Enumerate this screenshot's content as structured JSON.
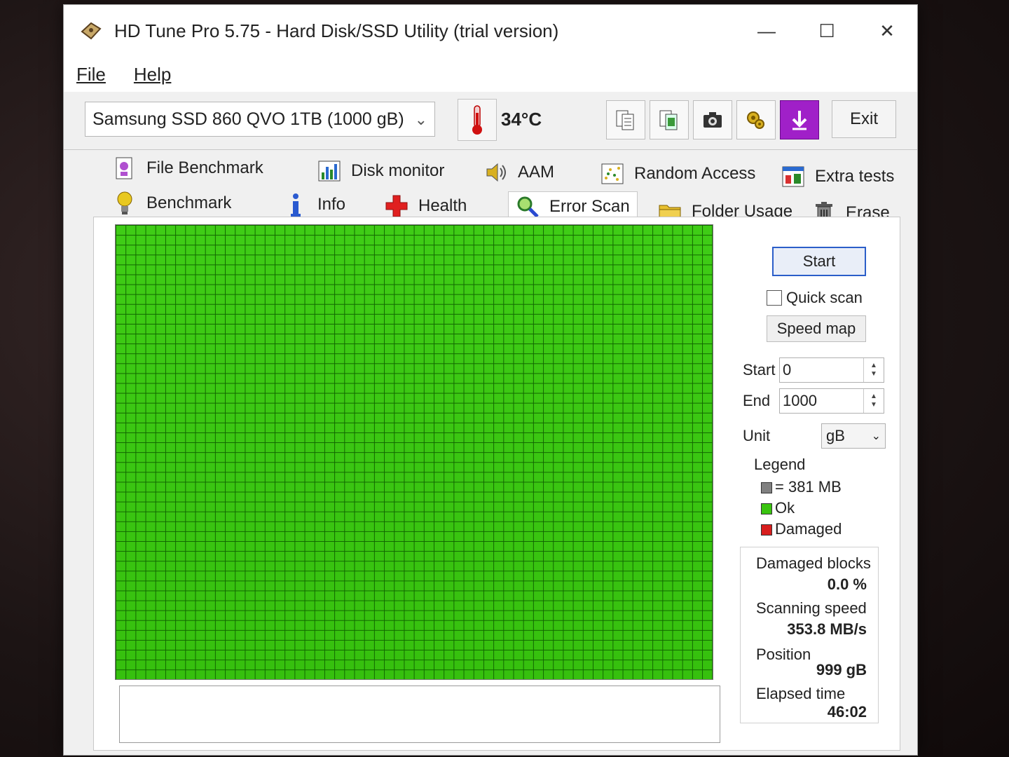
{
  "window": {
    "title": "HD Tune Pro 5.75 - Hard Disk/SSD Utility (trial version)"
  },
  "menu": {
    "file": "File",
    "help": "Help"
  },
  "toolbar": {
    "drive": "Samsung SSD 860 QVO 1TB (1000 gB)",
    "temperature": "34°C",
    "exit_label": "Exit"
  },
  "tabs": [
    {
      "label": "File Benchmark",
      "icon": "file-benchmark-icon"
    },
    {
      "label": "Disk monitor",
      "icon": "disk-monitor-icon"
    },
    {
      "label": "AAM",
      "icon": "speaker-icon"
    },
    {
      "label": "Random Access",
      "icon": "random-access-icon"
    },
    {
      "label": "Extra tests",
      "icon": "extra-tests-icon"
    },
    {
      "label": "Benchmark",
      "icon": "lightbulb-icon"
    },
    {
      "label": "Info",
      "icon": "info-icon"
    },
    {
      "label": "Health",
      "icon": "health-cross-icon"
    },
    {
      "label": "Error Scan",
      "icon": "magnifier-icon",
      "active": true
    },
    {
      "label": "Folder Usage",
      "icon": "folder-icon"
    },
    {
      "label": "Erase",
      "icon": "trash-icon"
    }
  ],
  "scan": {
    "start_button": "Start",
    "quick_scan": "Quick scan",
    "speed_map": "Speed map",
    "start_label": "Start",
    "start_value": "0",
    "end_label": "End",
    "end_value": "1000",
    "unit_label": "Unit",
    "unit_value": "gB"
  },
  "legend": {
    "title": "Legend",
    "block": "= 381 MB",
    "ok": "Ok",
    "damaged": "Damaged"
  },
  "stats": {
    "damaged_blocks_label": "Damaged blocks",
    "damaged_blocks_value": "0.0 %",
    "scanning_speed_label": "Scanning speed",
    "scanning_speed_value": "353.8 MB/s",
    "position_label": "Position",
    "position_value": "999 gB",
    "elapsed_label": "Elapsed time",
    "elapsed_value": "46:02"
  },
  "colors": {
    "ok": "#39c40f",
    "damaged": "#d81e1e",
    "block": "#808080",
    "accent": "#2b5ec9"
  }
}
